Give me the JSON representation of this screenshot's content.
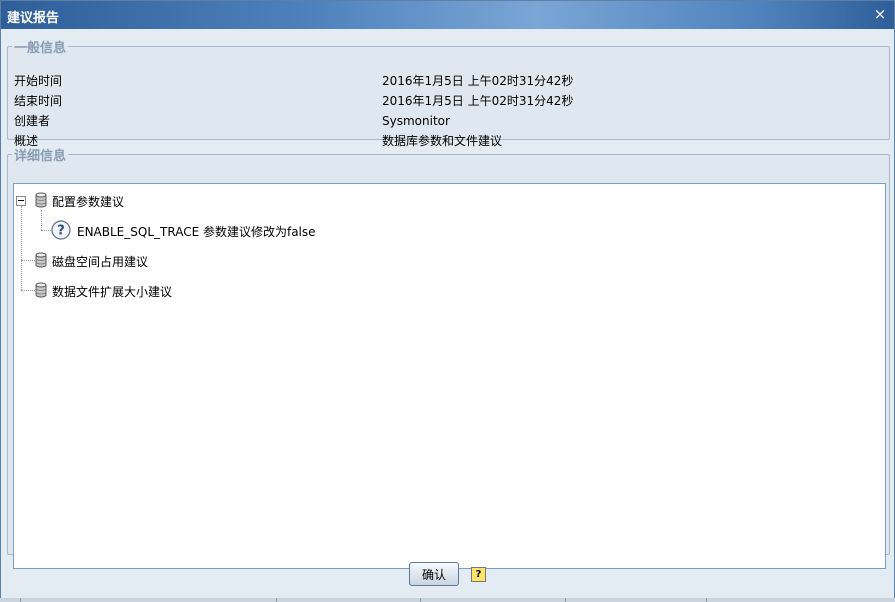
{
  "window": {
    "title": "建议报告",
    "close_glyph": "×"
  },
  "general": {
    "legend": "一般信息",
    "rows": [
      {
        "label": "开始时间",
        "value": "2016年1月5日 上午02时31分42秒"
      },
      {
        "label": "结束时间",
        "value": "2016年1月5日 上午02时31分42秒"
      },
      {
        "label": "创建者",
        "value": "Sysmonitor"
      },
      {
        "label": "概述",
        "value": "数据库参数和文件建议"
      }
    ]
  },
  "detail": {
    "legend": "详细信息",
    "tree": [
      {
        "label": "配置参数建议",
        "icon": "database-icon",
        "expanded": true,
        "children": [
          {
            "label": "ENABLE_SQL_TRACE 参数建议修改为false",
            "icon": "question-icon"
          }
        ]
      },
      {
        "label": "磁盘空间占用建议",
        "icon": "database-icon"
      },
      {
        "label": "数据文件扩展大小建议",
        "icon": "database-icon"
      }
    ]
  },
  "footer": {
    "ok_label": "确认",
    "help_glyph": "?"
  },
  "colors": {
    "titlebar": "#4f82bd",
    "legend_text": "#8a9db4",
    "panel_bg": "#dfe8f1",
    "tree_bg": "#ffffff"
  }
}
